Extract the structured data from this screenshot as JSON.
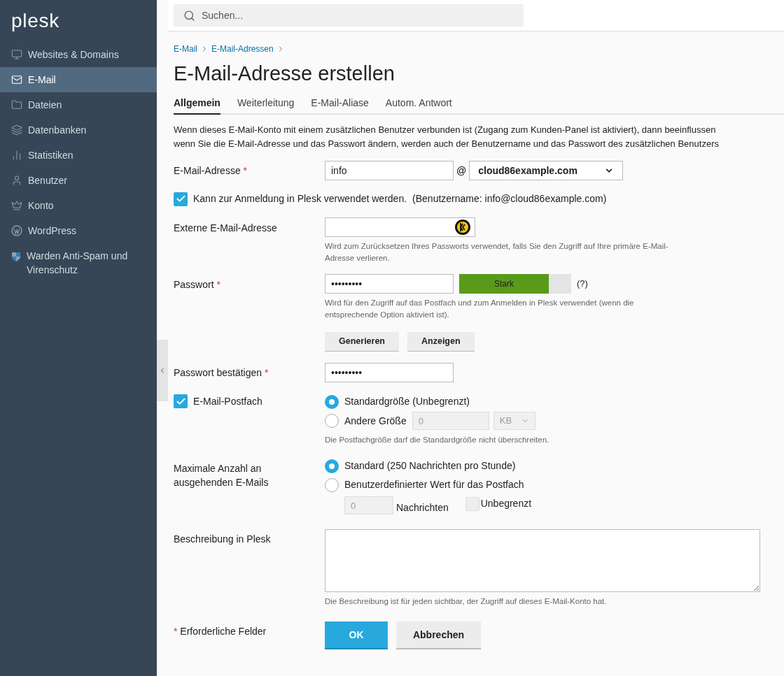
{
  "sidebar": {
    "logo": "plesk",
    "items": [
      {
        "label": "Websites & Domains",
        "kind": "monitor",
        "selected": false
      },
      {
        "label": "E-Mail",
        "kind": "mail",
        "selected": true
      },
      {
        "label": "Dateien",
        "kind": "folder",
        "selected": false
      },
      {
        "label": "Datenbanken",
        "kind": "layers",
        "selected": false
      },
      {
        "label": "Statistiken",
        "kind": "chart",
        "selected": false
      },
      {
        "label": "Benutzer",
        "kind": "user",
        "selected": false
      },
      {
        "label": "Konto",
        "kind": "crown",
        "selected": false
      },
      {
        "label": "WordPress",
        "kind": "wordpress",
        "selected": false
      },
      {
        "label": "Warden Anti-Spam und Virenschutz",
        "kind": "shield",
        "selected": false
      }
    ]
  },
  "search": {
    "placeholder": "Suchen..."
  },
  "breadcrumbs": [
    "E-Mail",
    "E-Mail-Adressen"
  ],
  "title": "E-Mail-Adresse erstellen",
  "tabs": [
    {
      "label": "Allgemein",
      "selected": true
    },
    {
      "label": "Weiterleitung",
      "selected": false
    },
    {
      "label": "E-Mail-Aliase",
      "selected": false
    },
    {
      "label": "Autom. Antwort",
      "selected": false
    }
  ],
  "intro_lines": [
    "Wenn dieses E-Mail-Konto mit einem zusätzlichen Benutzer verbunden ist (Zugang zum Kunden-Panel ist aktiviert), dann beeinflussen",
    "wenn Sie die E-Mail-Adresse und das Passwort ändern, werden auch der Benutzername und das Passwort des zusätzlichen Benutzers"
  ],
  "email": {
    "label": "E-Mail-Adresse",
    "required": true,
    "value": "info",
    "at": "@",
    "domain": "cloud86example.com"
  },
  "login": {
    "label": "Kann zur Anmeldung in Plesk verwendet werden.",
    "note": "(Benutzername: info@cloud86example.com)",
    "checked": true
  },
  "external": {
    "label": "Externe E-Mail-Adresse",
    "hint": "Wird zum Zurücksetzen Ihres Passworts verwendet, falls Sie den Zugriff auf Ihre primäre E-Mail-Adresse verlieren."
  },
  "password": {
    "label": "Passwort",
    "required": true,
    "value": "•••••••••",
    "strength": "Stark",
    "level": 0.8,
    "help": "(?)",
    "hint": "Wird für den Zugriff auf das Postfach und zum Anmelden in Plesk verwendet (wenn die entsprechende Option aktiviert ist).",
    "buttons": [
      "Generieren",
      "Anzeigen"
    ]
  },
  "confirm": {
    "label": "Passwort bestätigen",
    "required": true,
    "value": "•••••••••"
  },
  "mailbox": {
    "label": "E-Mail-Postfach",
    "checked": true,
    "options": [
      {
        "label": "Standardgröße (Unbegrenzt)",
        "selected": true
      },
      {
        "label": "Andere Größe",
        "selected": false
      }
    ],
    "size_value": "0",
    "unit": "KB",
    "hint": "Die Postfachgröße darf die Standardgröße nicht überschreiten."
  },
  "outgoing": {
    "label": "Maximale Anzahl an ausgehenden E-Mails",
    "options": [
      {
        "label": "Standard (250 Nachrichten pro Stunde)",
        "selected": true
      },
      {
        "label": "Benutzerdefinierter Wert für das Postfach",
        "selected": false
      }
    ],
    "count_value": "0",
    "count_unit": "Nachrichten",
    "unlimited": {
      "label": "Unbegrenzt",
      "checked": false
    }
  },
  "description": {
    "label": "Beschreibung in Plesk",
    "hint": "Die Beschreibung ist für jeden sichtbar, der Zugriff auf dieses E-Mail-Konto hat."
  },
  "footer": {
    "required_mark": "*",
    "required_note": "Erforderliche Felder",
    "ok": "OK",
    "cancel": "Abbrechen"
  }
}
